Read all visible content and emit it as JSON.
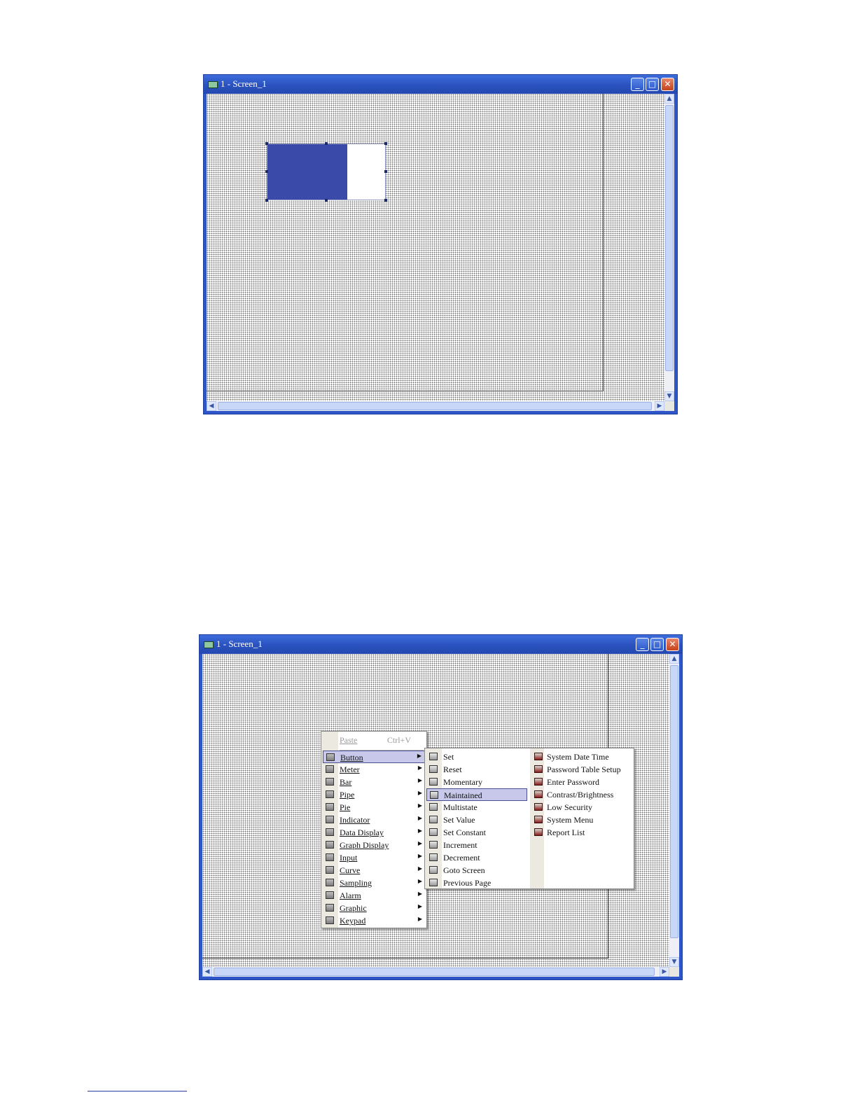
{
  "window_top": {
    "title": "1 - Screen_1"
  },
  "window_bottom": {
    "title": "1 - Screen_1"
  },
  "window_controls": {
    "minimize": "_",
    "maximize": "□",
    "close": "✕"
  },
  "scroll": {
    "up": "▲",
    "down": "▼",
    "left": "◀",
    "right": "▶"
  },
  "context_menu": {
    "paste": {
      "label": "Paste",
      "shortcut": "Ctrl+V"
    },
    "items": [
      {
        "label": "Button",
        "icon": "button-icon"
      },
      {
        "label": "Meter",
        "icon": "meter-icon"
      },
      {
        "label": "Bar",
        "icon": "bar-icon"
      },
      {
        "label": "Pipe",
        "icon": "pipe-icon"
      },
      {
        "label": "Pie",
        "icon": "pie-icon"
      },
      {
        "label": "Indicator",
        "icon": "indicator-icon"
      },
      {
        "label": "Data Display",
        "icon": "data-display-icon"
      },
      {
        "label": "Graph Display",
        "icon": "graph-display-icon"
      },
      {
        "label": "Input",
        "icon": "input-icon"
      },
      {
        "label": "Curve",
        "icon": "curve-icon"
      },
      {
        "label": "Sampling",
        "icon": "sampling-icon"
      },
      {
        "label": "Alarm",
        "icon": "alarm-icon"
      },
      {
        "label": "Graphic",
        "icon": "graphic-icon"
      },
      {
        "label": "Keypad",
        "icon": "keypad-icon"
      }
    ],
    "selected": "Button",
    "arrow": "▶"
  },
  "button_submenu": {
    "col1": [
      "Set",
      "Reset",
      "Momentary",
      "Maintained",
      "Multistate",
      "Set Value",
      "Set Constant",
      "Increment",
      "Decrement",
      "Goto Screen",
      "Previous Page"
    ],
    "col2": [
      "System Date Time",
      "Password Table Setup",
      "Enter Password",
      "Contrast/Brightness",
      "Low Security",
      "System Menu",
      "Report List"
    ],
    "selected": "Maintained"
  },
  "colors": {
    "title_bar": "#2a52be",
    "selected_object": "#3a4aa8",
    "menu_highlight": "#c7c8ea"
  }
}
